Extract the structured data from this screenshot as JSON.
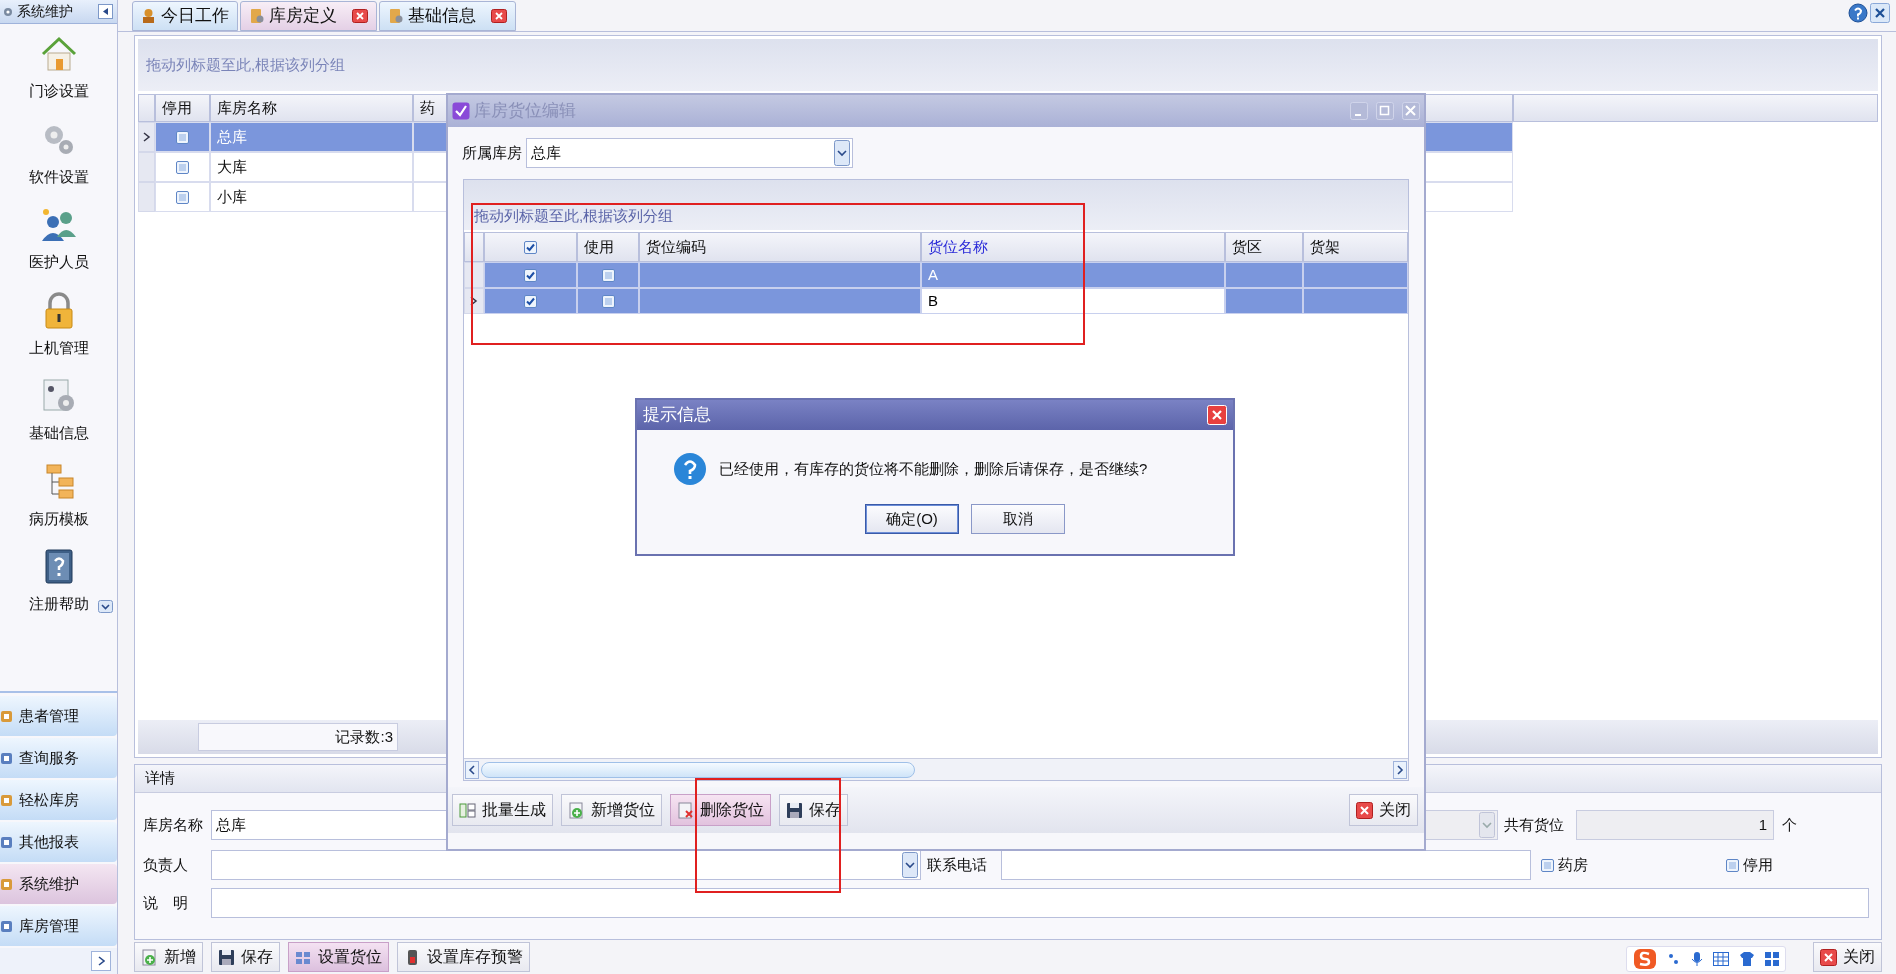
{
  "sidebar": {
    "header": "系统维护",
    "items": [
      {
        "label": "门诊设置"
      },
      {
        "label": "软件设置"
      },
      {
        "label": "医护人员"
      },
      {
        "label": "上机管理"
      },
      {
        "label": "基础信息"
      },
      {
        "label": "病历模板"
      },
      {
        "label": "注册帮助"
      }
    ],
    "nav": [
      {
        "label": "患者管理",
        "selected": false
      },
      {
        "label": "查询服务",
        "selected": false
      },
      {
        "label": "轻松库房",
        "selected": false
      },
      {
        "label": "其他报表",
        "selected": false
      },
      {
        "label": "系统维护",
        "selected": true
      },
      {
        "label": "库房管理",
        "selected": false
      }
    ]
  },
  "tabs": [
    {
      "label": "今日工作",
      "selected": false,
      "closable": false
    },
    {
      "label": "库房定义",
      "selected": true,
      "closable": true
    },
    {
      "label": "基础信息",
      "selected": false,
      "closable": true
    }
  ],
  "main_grid": {
    "group_hint": "拖动列标题至此,根据该列分组",
    "columns": [
      "停用",
      "库房名称",
      "药"
    ],
    "rows": [
      {
        "disabled": false,
        "name": "总库",
        "selected": true
      },
      {
        "disabled": false,
        "name": "大库",
        "selected": false
      },
      {
        "disabled": false,
        "name": "小库",
        "selected": false
      }
    ],
    "record_count": "记录数:3"
  },
  "details": {
    "title": "详情",
    "name_label": "库房名称",
    "name_value": "总库",
    "manager_label": "负责人",
    "phone_label": "联系电话",
    "count_label": "共有货位",
    "count_value": "1",
    "count_unit": "个",
    "pharmacy": {
      "label": "药房",
      "checked": false
    },
    "disabled": {
      "label": "停用",
      "checked": false
    },
    "note_label": "说　明"
  },
  "toolbar": [
    {
      "label": "新增",
      "selected": false
    },
    {
      "label": "保存",
      "selected": false
    },
    {
      "label": "设置货位",
      "selected": true
    },
    {
      "label": "设置库存预警",
      "selected": false
    }
  ],
  "close_button": "关闭",
  "dialog": {
    "title": "库房货位编辑",
    "warehouse_label": "所属库房",
    "warehouse_value": "总库",
    "group_hint": "拖动列标题至此,根据该列分组",
    "header_checked": true,
    "columns": [
      "使用",
      "货位编码",
      "货位名称",
      "货区",
      "货架"
    ],
    "rows": [
      {
        "checked": true,
        "in_use": false,
        "name": "A",
        "selected": true,
        "current": false
      },
      {
        "checked": true,
        "in_use": false,
        "name": "B",
        "selected": true,
        "current": true
      }
    ],
    "buttons": [
      {
        "label": "批量生成",
        "hover": false
      },
      {
        "label": "新增货位",
        "hover": false
      },
      {
        "label": "删除货位",
        "hover": true
      },
      {
        "label": "保存",
        "hover": false
      }
    ],
    "close": "关闭"
  },
  "message": {
    "title": "提示信息",
    "text": "已经使用，有库存的货位将不能删除，删除后请保存，是否继续?",
    "buttons": [
      {
        "label": "确定(O)",
        "default": true
      },
      {
        "label": "取消",
        "default": false
      }
    ]
  }
}
